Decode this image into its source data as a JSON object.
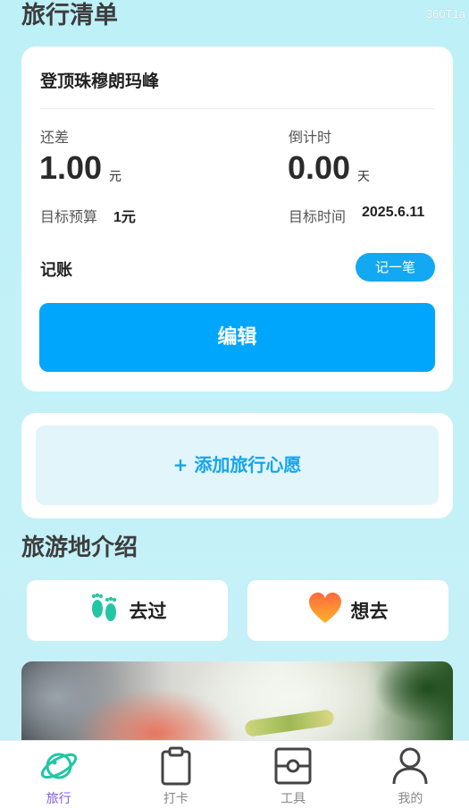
{
  "header": {
    "title": "旅行清单",
    "watermark": "360T1a"
  },
  "plan": {
    "name": "登顶珠穆朗玛峰",
    "remaining_label": "还差",
    "remaining_value": "1.00",
    "remaining_unit": "元",
    "countdown_label": "倒计时",
    "countdown_value": "0.00",
    "countdown_unit": "天",
    "budget_label": "目标预算",
    "budget_value": "1元",
    "target_time_label": "目标时间",
    "target_time_value": "2025.6.11",
    "ledger_title": "记账",
    "record_button": "记一笔",
    "edit_button": "编辑"
  },
  "wish": {
    "add_button": "+ 添加旅行心愿"
  },
  "intro": {
    "title": "旅游地介绍",
    "visited_label": "去过",
    "visited_icon": "footprints-icon",
    "want_label": "想去",
    "want_icon": "heart-icon"
  },
  "tabbar": {
    "items": [
      {
        "label": "旅行",
        "icon": "planet-icon",
        "active": true
      },
      {
        "label": "打卡",
        "icon": "clipboard-icon",
        "active": false
      },
      {
        "label": "工具",
        "icon": "toolbox-icon",
        "active": false
      },
      {
        "label": "我的",
        "icon": "person-icon",
        "active": false
      }
    ]
  },
  "colors": {
    "accent": "#00a6fb",
    "background": "#bdf0f7",
    "tab_active": "#7a5de0"
  }
}
